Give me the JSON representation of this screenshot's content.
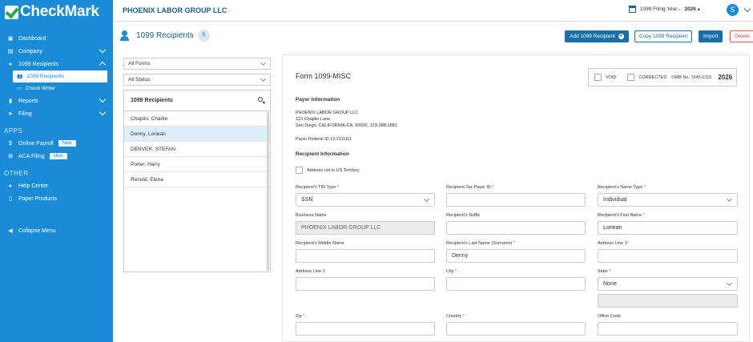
{
  "brand": {
    "name": "CheckMark"
  },
  "sidebar": {
    "items": [
      {
        "label": "Dashboard"
      },
      {
        "label": "Company"
      },
      {
        "label": "1099 Recipients"
      }
    ],
    "sub": [
      {
        "label": "1099 Recipients"
      },
      {
        "label": "Check Writer"
      }
    ],
    "items2": [
      {
        "label": "Reports"
      },
      {
        "label": "Filing"
      }
    ],
    "apps_title": "APPS",
    "apps": [
      {
        "label": "Online Payroll",
        "badge": "New"
      },
      {
        "label": "ACA Filing",
        "badge": "New"
      }
    ],
    "other_title": "OTHER",
    "other": [
      {
        "label": "Help Center"
      },
      {
        "label": "Paper Products"
      }
    ],
    "collapse_label": "Collapse Menu"
  },
  "topbar": {
    "company": "PHOENIX LABOR GROUP LLC",
    "filing_label": "1099 Filing Year -",
    "filing_year": "2026",
    "avatar": "S"
  },
  "page": {
    "title": "1099 Recipients",
    "count": "5",
    "buttons": {
      "add": "Add 1099 Recipient",
      "copy": "Copy 1099 Recipient",
      "import": "Import",
      "delete": "Delete"
    }
  },
  "list": {
    "forms_filter": "All Forms",
    "status_filter": "All Status",
    "header": "1099 Recipients",
    "rows": [
      "Chaplin, Charlie",
      "Denny, Loriean",
      "DENVER, STEFAN",
      "Porter, Harry",
      "Renold, Elena"
    ]
  },
  "form": {
    "title": "Form 1099-MISC",
    "void_label": "VOID",
    "corrected_label": "CORRECTED",
    "omb": "OMB No. 1545-0115",
    "year": "2026",
    "payer_title": "Payer Information",
    "payer_lines": [
      "PHOENIX LABOR GROUP LLC",
      "123 Chaplin Lane,",
      "San Diego, CALIFORNIA-CA, 90000, 123-388-1881"
    ],
    "payer_fed": "Payer Federal ID 12-1111111",
    "recipient_title": "Recipient Information",
    "address_not_us": "Address not in US Territory",
    "fields": {
      "tin_type": {
        "label": "Recipient's TIN Type",
        "value": "SSN"
      },
      "tax_payer_id": {
        "label": "Recipient Tax Payer ID",
        "value": ""
      },
      "name_type": {
        "label": "Recipient's Name Type",
        "value": "Individual"
      },
      "business_name": {
        "label": "Business Name",
        "value": "PHOENIX LABOR GROUP LLC"
      },
      "suffix": {
        "label": "Recipient's Suffix",
        "value": ""
      },
      "first_name": {
        "label": "Recipient's First Name",
        "value": "Loriean"
      },
      "middle_name": {
        "label": "Recipient's Middle Name",
        "value": ""
      },
      "last_name": {
        "label": "Recipient's Last Name (Surname)",
        "value": "Denny"
      },
      "address1": {
        "label": "Address Line 1",
        "value": ""
      },
      "address2": {
        "label": "Address Line 2",
        "value": ""
      },
      "city": {
        "label": "City",
        "value": ""
      },
      "state": {
        "label": "State",
        "value": "None"
      },
      "zip": {
        "label": "Zip",
        "value": ""
      },
      "country": {
        "label": "Country",
        "value": ""
      },
      "office_code": {
        "label": "Office Code",
        "value": ""
      }
    }
  },
  "colors": {
    "sidebar": "#1a8bd6",
    "primary": "#1a6fa8",
    "danger": "#e05050"
  }
}
